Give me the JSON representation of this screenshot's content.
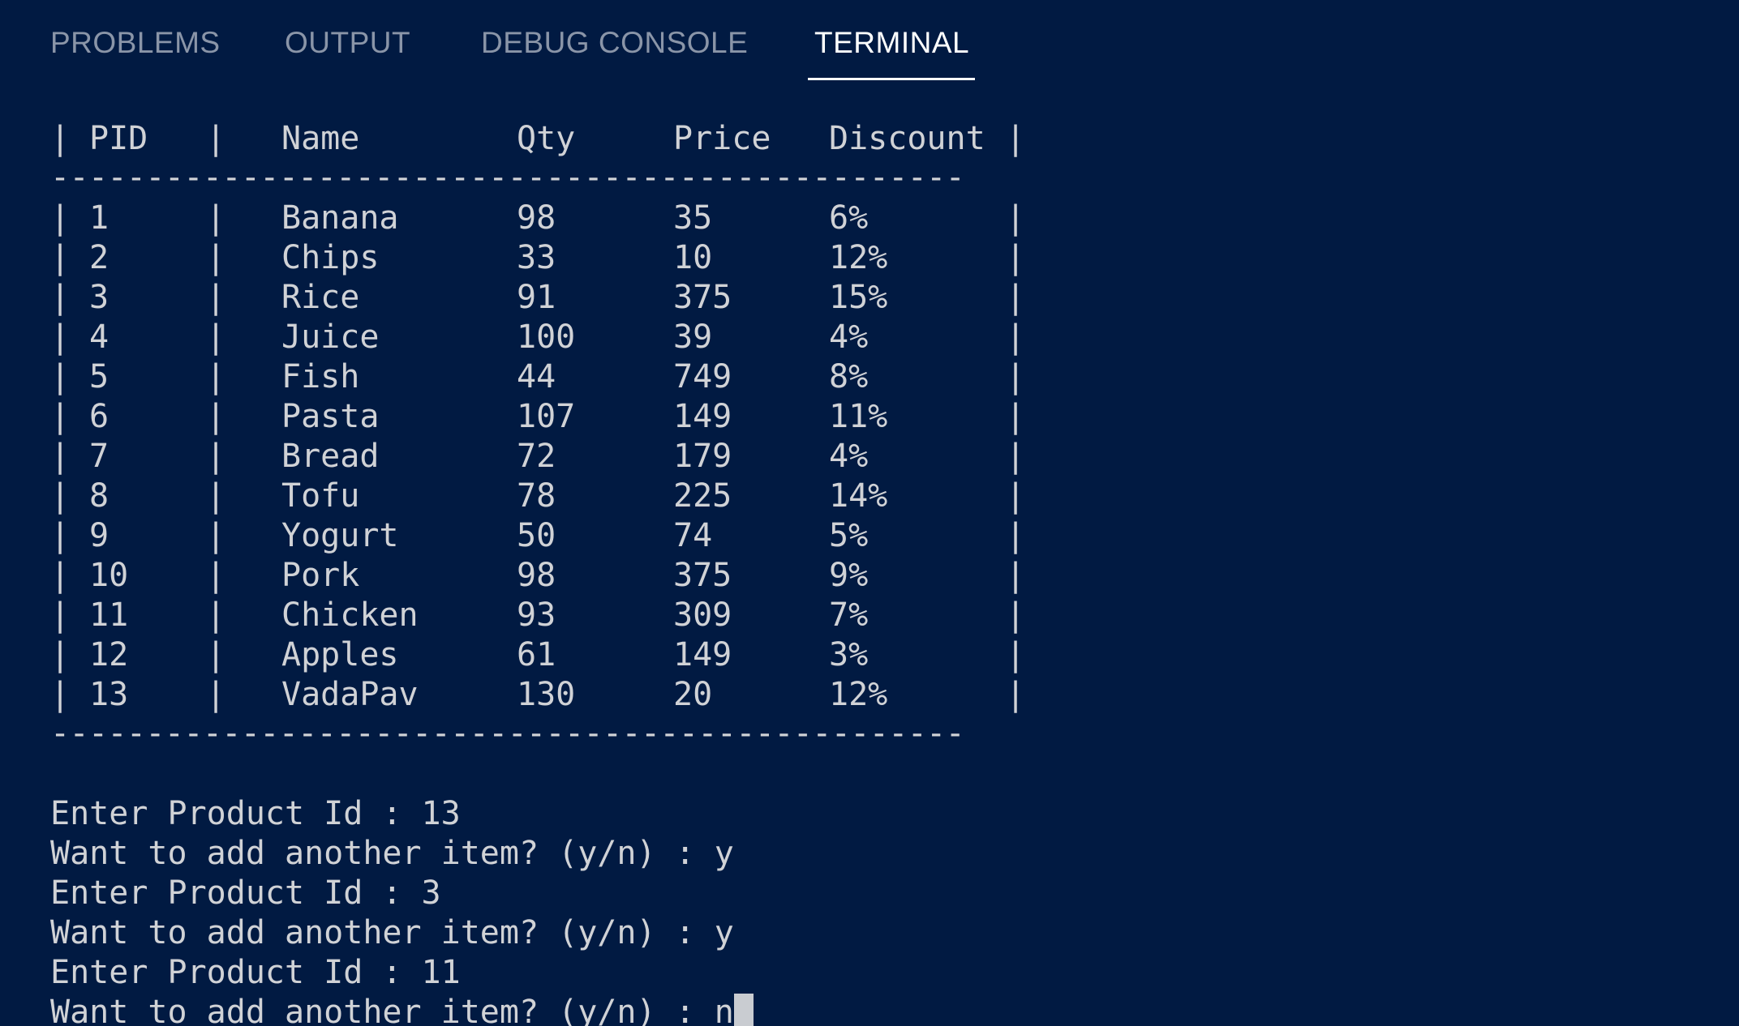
{
  "tabs": [
    {
      "label": "PROBLEMS"
    },
    {
      "label": "OUTPUT"
    },
    {
      "label": "DEBUG CONSOLE"
    },
    {
      "label": "TERMINAL",
      "active": true
    }
  ],
  "table": {
    "headers": [
      "PID",
      "Name",
      "Qty",
      "Price",
      "Discount"
    ],
    "separator": "------------------------------------------------",
    "pipe": "|",
    "rows": [
      [
        "1",
        "Banana",
        "98",
        "35",
        "6%"
      ],
      [
        "2",
        "Chips",
        "33",
        "10",
        "12%"
      ],
      [
        "3",
        "Rice",
        "91",
        "375",
        "15%"
      ],
      [
        "4",
        "Juice",
        "100",
        "39",
        "4%"
      ],
      [
        "5",
        "Fish",
        "44",
        "749",
        "8%"
      ],
      [
        "6",
        "Pasta",
        "107",
        "149",
        "11%"
      ],
      [
        "7",
        "Bread",
        "72",
        "179",
        "4%"
      ],
      [
        "8",
        "Tofu",
        "78",
        "225",
        "14%"
      ],
      [
        "9",
        "Yogurt",
        "50",
        "74",
        "5%"
      ],
      [
        "10",
        "Pork",
        "98",
        "375",
        "9%"
      ],
      [
        "11",
        "Chicken",
        "93",
        "309",
        "7%"
      ],
      [
        "12",
        "Apples",
        "61",
        "149",
        "3%"
      ],
      [
        "13",
        "VadaPav",
        "130",
        "20",
        "12%"
      ]
    ]
  },
  "prompts": [
    "Enter Product Id : 13",
    "Want to add another item? (y/n) : y",
    "Enter Product Id : 3",
    "Want to add another item? (y/n) : y",
    "Enter Product Id : 11",
    "Want to add another item? (y/n) : n"
  ],
  "colors": {
    "background": "#011a42",
    "text": "#d0d2d6",
    "tab_inactive": "#8a95a8",
    "tab_active": "#ffffff"
  }
}
